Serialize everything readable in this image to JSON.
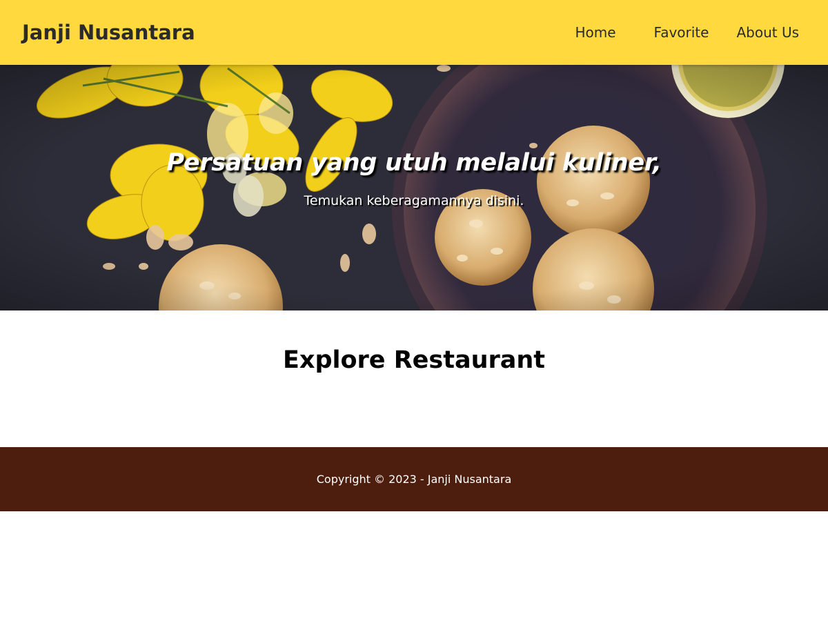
{
  "header": {
    "brand": "Janji Nusantara",
    "nav": [
      {
        "label": "Home"
      },
      {
        "label": "Favorite"
      },
      {
        "label": "About Us"
      }
    ]
  },
  "hero": {
    "title": "Persatuan yang utuh melalui kuliner,",
    "tagline": "Temukan keberagamannya disini."
  },
  "main": {
    "heading": "Explore Restaurant"
  },
  "footer": {
    "copyright": "Copyright © 2023 - Janji Nusantara"
  },
  "colors": {
    "header_bg": "#ffd93d",
    "footer_bg": "#4d1e0e",
    "hero_bg": "#2b2c37"
  }
}
